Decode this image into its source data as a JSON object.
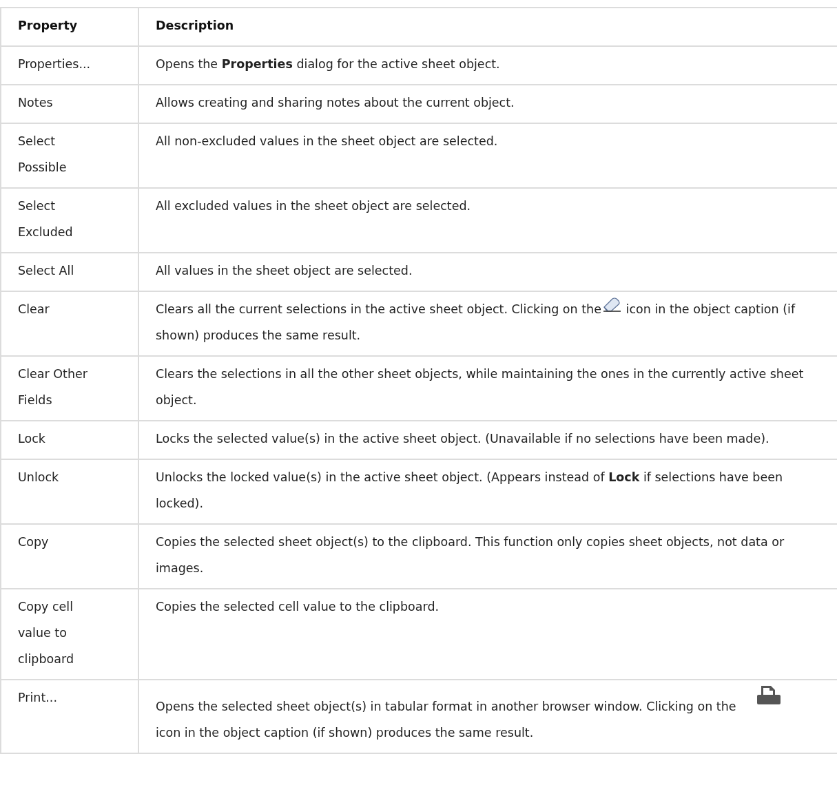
{
  "table": {
    "columns": [
      "Property",
      "Description"
    ],
    "rows": [
      {
        "property": "Properties...",
        "description": [
          "Opens the **Properties** dialog for the active sheet object."
        ]
      },
      {
        "property": "Notes",
        "description": [
          "Allows creating and sharing notes about the current object."
        ]
      },
      {
        "property": "Select Possible",
        "description": [
          "All non-excluded values in the sheet object are selected."
        ]
      },
      {
        "property": "Select Excluded",
        "description": [
          "All excluded values in the sheet object are selected."
        ]
      },
      {
        "property": "Select All",
        "description": [
          "All values in the sheet object are selected."
        ]
      },
      {
        "property": "Clear",
        "kind": "clear-icon",
        "description": [
          "Clears all the current selections in the active sheet object. Clicking on the",
          "icon in the object caption (if shown) produces the same result."
        ]
      },
      {
        "property": "Clear Other Fields",
        "description": [
          "Clears the selections in all the other sheet objects, while maintaining the ones in the currently active sheet object."
        ]
      },
      {
        "property": "Lock",
        "description": [
          "Locks the selected value(s) in the active sheet object. (Unavailable if no selections have been made)."
        ]
      },
      {
        "property": "Unlock",
        "description": [
          "Unlocks the locked value(s) in the active sheet object. (Appears instead of **Lock** if selections have been locked)."
        ]
      },
      {
        "property": "Copy",
        "description": [
          "Copies the selected sheet object(s) to the clipboard. This function only copies sheet objects, not data or images."
        ]
      },
      {
        "property": "Copy cell value to clipboard",
        "description": [
          "Copies the selected cell value to the clipboard."
        ]
      },
      {
        "property": "Print...",
        "kind": "print-icon",
        "description": [
          "Opens the selected sheet object(s) in tabular format in another browser window. Clicking on the",
          "icon in the object caption (if shown) produces the same result."
        ]
      }
    ]
  }
}
